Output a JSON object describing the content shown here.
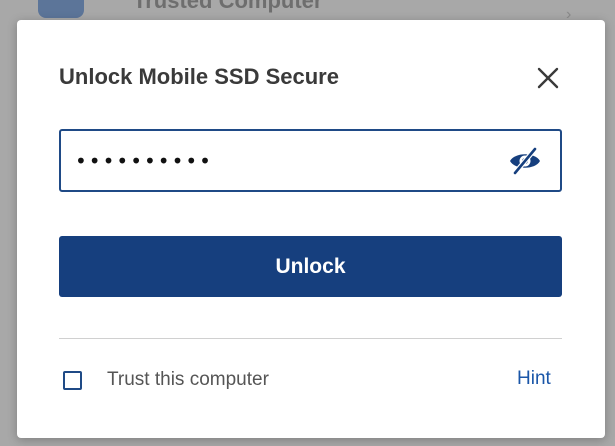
{
  "background": {
    "text": "Trusted Computer"
  },
  "dialog": {
    "title": "Unlock Mobile SSD Secure",
    "password": {
      "value": "••••••••••",
      "masked": true
    },
    "unlock_label": "Unlock",
    "trust_label": "Trust this computer",
    "trust_checked": false,
    "hint_label": "Hint"
  },
  "icons": {
    "close": "close-icon",
    "visibility": "eye-slash-icon",
    "background_app": "app-icon"
  },
  "colors": {
    "primary": "#163f7e",
    "field_border": "#1f4a86",
    "link": "#1a56a8",
    "title_text": "#3a3a3a"
  }
}
